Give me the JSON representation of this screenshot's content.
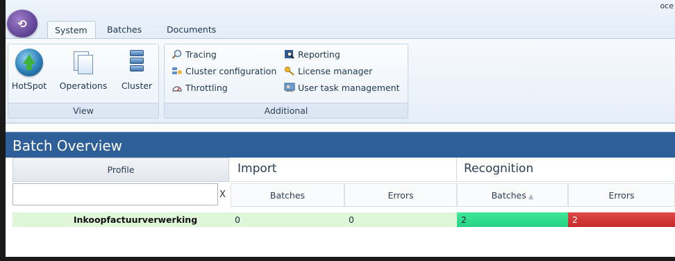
{
  "window": {
    "corner_text": "oce"
  },
  "ribbon": {
    "tabs": [
      {
        "label": "System",
        "active": true
      },
      {
        "label": "Batches",
        "active": false
      },
      {
        "label": "Documents",
        "active": false
      }
    ],
    "groups": {
      "view": {
        "caption": "View",
        "buttons": [
          {
            "label": "HotSpot",
            "icon": "globe-arrow-icon"
          },
          {
            "label": "Operations",
            "icon": "documents-icon"
          },
          {
            "label": "Cluster",
            "icon": "server-icon"
          }
        ]
      },
      "additional": {
        "caption": "Additional",
        "buttons": [
          {
            "label": "Tracing",
            "icon": "magnifier-icon"
          },
          {
            "label": "Cluster configuration",
            "icon": "cluster-config-icon"
          },
          {
            "label": "Throttling",
            "icon": "gauge-icon"
          },
          {
            "label": "Reporting",
            "icon": "report-icon"
          },
          {
            "label": "License manager",
            "icon": "key-icon"
          },
          {
            "label": "User task management",
            "icon": "user-task-icon"
          }
        ]
      }
    }
  },
  "overview": {
    "title": "Batch Overview",
    "columns": {
      "profile": "Profile",
      "import": "Import",
      "recognition": "Recognition",
      "import_batches": "Batches",
      "import_errors": "Errors",
      "recognition_batches": "Batches",
      "recognition_errors": "Errors",
      "sort_indicator": "▲"
    },
    "filter": {
      "value": "",
      "clear_label": "X"
    },
    "rows": [
      {
        "profile": "Inkoopfactuurverwerking",
        "import_batches": "0",
        "import_errors": "0",
        "recognition_batches": "2",
        "recognition_errors": "2"
      }
    ]
  },
  "colors": {
    "header_blue": "#2f5f98",
    "ok_green": "#dff7d8",
    "active_green": "#2fdc8d",
    "error_red": "#d43a3a"
  }
}
